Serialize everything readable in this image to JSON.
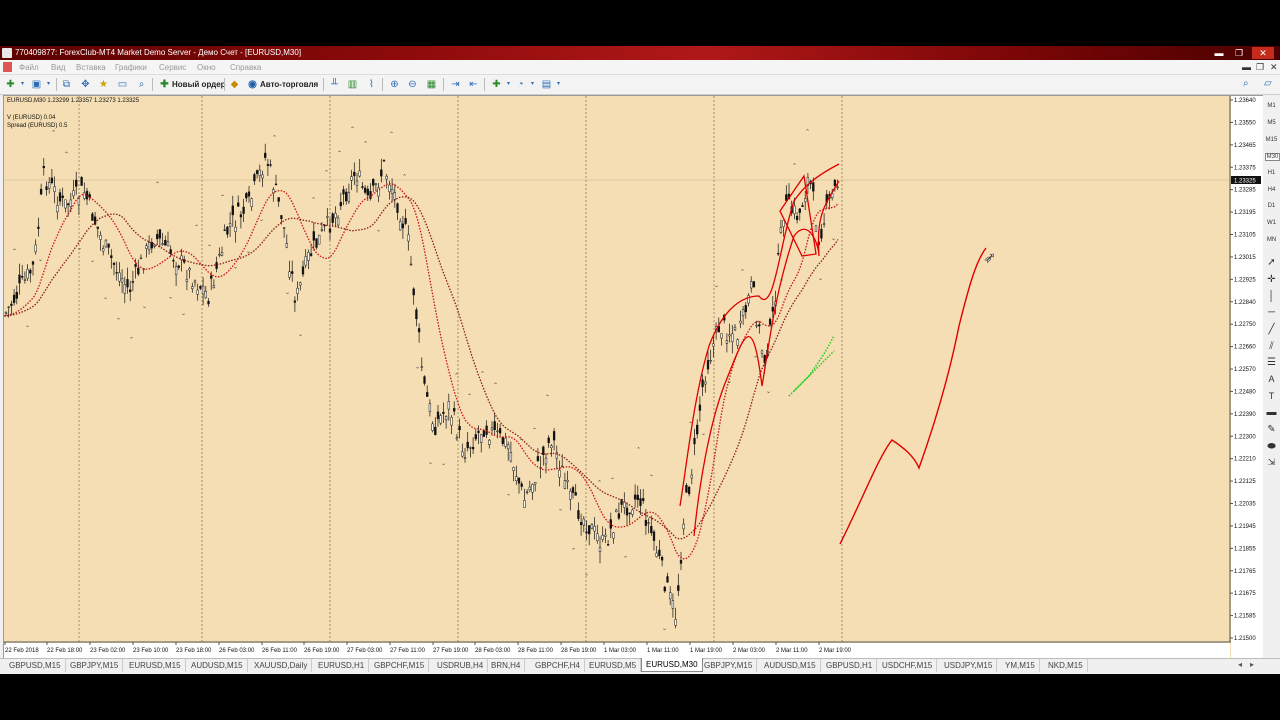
{
  "window": {
    "title": "770409877: ForexClub-MT4 Market Demo Server - Демо Счет - [EURUSD,M30]",
    "controls": [
      "▬",
      "❐",
      "✕"
    ]
  },
  "menu": {
    "items": [
      "Файл",
      "Вид",
      "Вставка",
      "Графики",
      "Сервис",
      "Окно",
      "Справка"
    ],
    "right": [
      "▬",
      "❐",
      "✕"
    ]
  },
  "toolbar": {
    "new_order": "Новый ордер",
    "auto_trading": "Авто-торговля"
  },
  "chart": {
    "symbol_line": "EURUSD,M30  1.23299 1.23357 1.23273 1.23325",
    "indicator1": "V (EURUSD) 0.04",
    "indicator2": "Spread (EURUSD) 0.5",
    "current_price": "1.23325",
    "price_ticks": [
      "1.23640",
      "1.23550",
      "1.23465",
      "1.23375",
      "1.23285",
      "1.23195",
      "1.23105",
      "1.23015",
      "1.22925",
      "1.22840",
      "1.22750",
      "1.22660",
      "1.22570",
      "1.22480",
      "1.22390",
      "1.22300",
      "1.22210",
      "1.22125",
      "1.22035",
      "1.21945",
      "1.21855",
      "1.21765",
      "1.21675",
      "1.21585",
      "1.21500"
    ],
    "time_ticks": [
      "22 Feb 2018",
      "22 Feb 18:00",
      "23 Feb 02:00",
      "23 Feb 10:00",
      "23 Feb 18:00",
      "26 Feb 03:00",
      "26 Feb 11:00",
      "26 Feb 19:00",
      "27 Feb 03:00",
      "27 Feb 11:00",
      "27 Feb 19:00",
      "28 Feb 03:00",
      "28 Feb 11:00",
      "28 Feb 19:00",
      "1 Mar 03:00",
      "1 Mar 11:00",
      "1 Mar 19:00",
      "2 Mar 03:00",
      "2 Mar 11:00",
      "2 Mar 19:00"
    ],
    "colors": {
      "background": "#f5deb3",
      "candles": "#111111",
      "ma": "#cc1111",
      "drawing": "#e00000",
      "signal": "#22cc22"
    }
  },
  "timeframes": [
    "M1",
    "M5",
    "M15",
    "M30",
    "H1",
    "H4",
    "D1",
    "W1",
    "MN"
  ],
  "tabs": [
    "GBPUSD,M15",
    "GBPJPY,M15",
    "EURUSD,M15",
    "AUDUSD,M15",
    "XAUUSD,Daily",
    "EURUSD,H1",
    "GBPCHF,M15",
    "USDRUB,H4",
    "BRN,H4",
    "GBPCHF,H4",
    "EURUSD,M5",
    "EURUSD,M30",
    "GBPJPY,M15",
    "AUDUSD,M15",
    "GBPUSD,H1",
    "USDCHF,M15",
    "USDJPY,M15",
    "YM,M15",
    "NKD,M15"
  ],
  "active_tab": "EURUSD,M30"
}
